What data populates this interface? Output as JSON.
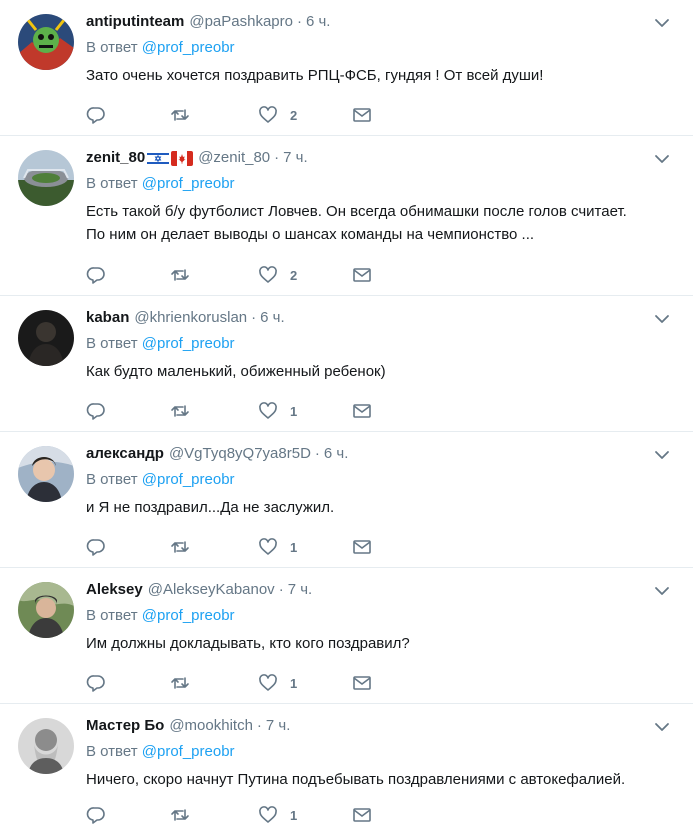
{
  "replying_prefix": "В ответ",
  "colors": {
    "accent": "#1da1f2",
    "muted": "#657786",
    "text": "#14171a",
    "divider": "#e6ecf0"
  },
  "tweets": [
    {
      "name": "antiputinteam",
      "handle": "@paPashkapro",
      "time": "6 ч.",
      "mention": "@prof_preobr",
      "lines": [
        "Зато очень хочется поздравить РПЦ-ФСБ, гундяя ! От всей души!"
      ],
      "likes": "2",
      "flags": []
    },
    {
      "name": "zenit_80",
      "handle": "@zenit_80",
      "time": "7 ч.",
      "mention": "@prof_preobr",
      "lines": [
        "Есть такой б/у футболист Ловчев. Он всегда обнимашки после голов считает.",
        "По ним он делает выводы о шансах команды на чемпионство ..."
      ],
      "likes": "2",
      "flags": [
        "israel-flag-icon",
        "canada-flag-icon"
      ]
    },
    {
      "name": "kaban",
      "handle": "@khrienkoruslan",
      "time": "6 ч.",
      "mention": "@prof_preobr",
      "lines": [
        "Как будто маленький, обиженный ребенок)"
      ],
      "likes": "1",
      "flags": []
    },
    {
      "name": "александр",
      "handle": "@VgTyq8yQ7ya8r5D",
      "time": "6 ч.",
      "mention": "@prof_preobr",
      "lines": [
        "и Я не поздравил...Да не заслужил."
      ],
      "likes": "1",
      "flags": []
    },
    {
      "name": "Aleksey",
      "handle": "@AlekseyKabanov",
      "time": "7 ч.",
      "mention": "@prof_preobr",
      "lines": [
        "Им должны докладывать, кто кого поздравил?"
      ],
      "likes": "1",
      "flags": []
    },
    {
      "name": "Мастер Бо",
      "handle": "@mookhitch",
      "time": "7 ч.",
      "mention": "@prof_preobr",
      "lines": [
        "Ничего, скоро начнут Путина подъебывать поздравлениями с автокефалией."
      ],
      "likes": "1",
      "flags": []
    }
  ]
}
